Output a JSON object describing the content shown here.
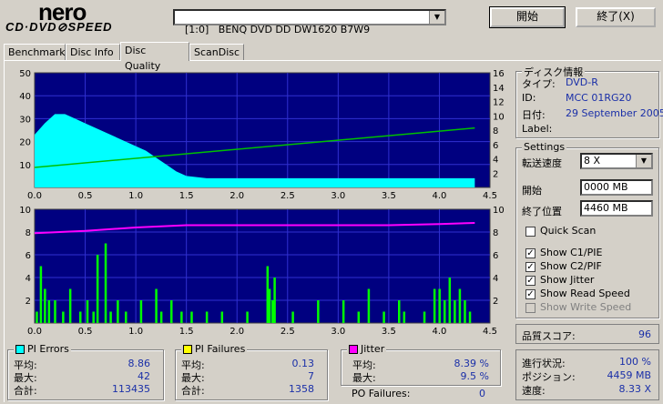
{
  "header": {
    "logo_top": "nero",
    "logo_bottom": "CD·DVD⊘SPEED",
    "drive": "[1:0]   BENQ DVD DD DW1620 B7W9",
    "start_button": "開始",
    "exit_button": "終了(X)"
  },
  "tabs": [
    "Benchmark",
    "Disc Info",
    "Disc Quality",
    "ScanDisc"
  ],
  "active_tab": "Disc Quality",
  "disc_info": {
    "title": "ディスク情報",
    "type_label": "タイプ:",
    "type_value": "DVD-R",
    "id_label": "ID:",
    "id_value": "MCC 01RG20",
    "date_label": "日付:",
    "date_value": "29 September 2005",
    "label_label": "Label:",
    "label_value": ""
  },
  "settings": {
    "title": "Settings",
    "speed_label": "転送速度",
    "speed_value": "8 X",
    "start_label": "開始",
    "start_value": "0000 MB",
    "end_label": "終了位置",
    "end_value": "4460 MB",
    "quick_scan": "Quick Scan",
    "checkboxes": [
      {
        "label": "Show C1/PIE",
        "checked": true,
        "enabled": true
      },
      {
        "label": "Show C2/PIF",
        "checked": true,
        "enabled": true
      },
      {
        "label": "Show Jitter",
        "checked": true,
        "enabled": true
      },
      {
        "label": "Show Read Speed",
        "checked": true,
        "enabled": true
      },
      {
        "label": "Show Write Speed",
        "checked": false,
        "enabled": false
      }
    ]
  },
  "quality": {
    "label": "品質スコア:",
    "value": "96"
  },
  "progress": {
    "status_label": "進行状況:",
    "status_value": "100 %",
    "position_label": "ポジション:",
    "position_value": "4459 MB",
    "speed_label": "速度:",
    "speed_value": "8.33 X"
  },
  "stats": {
    "pi_errors": {
      "title": "PI Errors",
      "color": "#00ffff",
      "avg_label": "平均:",
      "avg": "8.86",
      "max_label": "最大:",
      "max": "42",
      "total_label": "合計:",
      "total": "113435"
    },
    "pi_failures": {
      "title": "PI Failures",
      "color": "#ffff00",
      "avg_label": "平均:",
      "avg": "0.13",
      "max_label": "最大:",
      "max": "7",
      "total_label": "合計:",
      "total": "1358"
    },
    "jitter": {
      "title": "Jitter",
      "color": "#ff00ff",
      "avg_label": "平均:",
      "avg": "8.39 %",
      "max_label": "最大:",
      "max": "9.5 %",
      "po_label": "PO Failures:",
      "po": "0"
    }
  },
  "chart_data": [
    {
      "type": "area",
      "title": "",
      "xlim": [
        0,
        4.5
      ],
      "ylim_left": [
        0,
        50
      ],
      "ylim_right": [
        0,
        16
      ],
      "x_ticks": [
        "0.0",
        "0.5",
        "1.0",
        "1.5",
        "2.0",
        "2.5",
        "3.0",
        "3.5",
        "4.0",
        "4.5"
      ],
      "y_ticks_left": [
        "10",
        "20",
        "30",
        "40",
        "50"
      ],
      "y_ticks_right": [
        "2",
        "4",
        "6",
        "8",
        "10",
        "12",
        "14",
        "16"
      ],
      "series": [
        {
          "name": "PI Errors",
          "color": "#00ffff",
          "x": [
            0.0,
            0.1,
            0.2,
            0.3,
            0.4,
            0.5,
            0.6,
            0.7,
            0.8,
            0.9,
            1.0,
            1.1,
            1.2,
            1.3,
            1.4,
            1.5,
            1.7,
            2.0,
            2.5,
            3.0,
            3.5,
            4.0,
            4.3,
            4.35
          ],
          "y": [
            23,
            28,
            32,
            32,
            30,
            28,
            26,
            24,
            22,
            20,
            18,
            16,
            13,
            10,
            7,
            5,
            4,
            4,
            4,
            4,
            4,
            4,
            4,
            4
          ]
        },
        {
          "name": "Read Speed",
          "color": "#00c000",
          "x": [
            0.0,
            4.35
          ],
          "y": [
            2.8,
            8.3
          ]
        }
      ]
    },
    {
      "type": "bar",
      "title": "",
      "xlim": [
        0,
        4.5
      ],
      "ylim_left": [
        0,
        10
      ],
      "ylim_right": [
        0,
        10
      ],
      "x_ticks": [
        "0.0",
        "0.5",
        "1.0",
        "1.5",
        "2.0",
        "2.5",
        "3.0",
        "3.5",
        "4.0",
        "4.5"
      ],
      "y_ticks_left": [
        "2",
        "4",
        "6",
        "8",
        "10"
      ],
      "y_ticks_right": [
        "2",
        "4",
        "6",
        "8",
        "10"
      ],
      "series": [
        {
          "name": "PI Failures",
          "color": "#00ff00",
          "x": [
            0.02,
            0.06,
            0.1,
            0.14,
            0.2,
            0.28,
            0.35,
            0.45,
            0.52,
            0.58,
            0.62,
            0.7,
            0.75,
            0.82,
            0.9,
            1.05,
            1.2,
            1.25,
            1.35,
            1.45,
            1.55,
            1.7,
            1.85,
            2.1,
            2.3,
            2.32,
            2.35,
            2.37,
            2.55,
            2.8,
            3.05,
            3.2,
            3.3,
            3.45,
            3.6,
            3.65,
            3.85,
            3.95,
            4.0,
            4.05,
            4.1,
            4.15,
            4.2,
            4.25,
            4.3
          ],
          "y": [
            1,
            5,
            3,
            2,
            2,
            1,
            3,
            1,
            2,
            1,
            6,
            7,
            1,
            2,
            1,
            2,
            3,
            1,
            2,
            1,
            1,
            1,
            1,
            1,
            5,
            3,
            2,
            4,
            1,
            2,
            2,
            1,
            3,
            1,
            2,
            1,
            1,
            3,
            3,
            2,
            4,
            2,
            3,
            2,
            1
          ]
        },
        {
          "name": "Jitter",
          "color": "#ff00ff",
          "x": [
            0.0,
            0.5,
            1.0,
            1.5,
            2.0,
            2.5,
            3.0,
            3.5,
            4.0,
            4.35
          ],
          "y": [
            7.9,
            8.1,
            8.4,
            8.6,
            8.6,
            8.6,
            8.6,
            8.6,
            8.7,
            8.8
          ]
        }
      ]
    }
  ]
}
